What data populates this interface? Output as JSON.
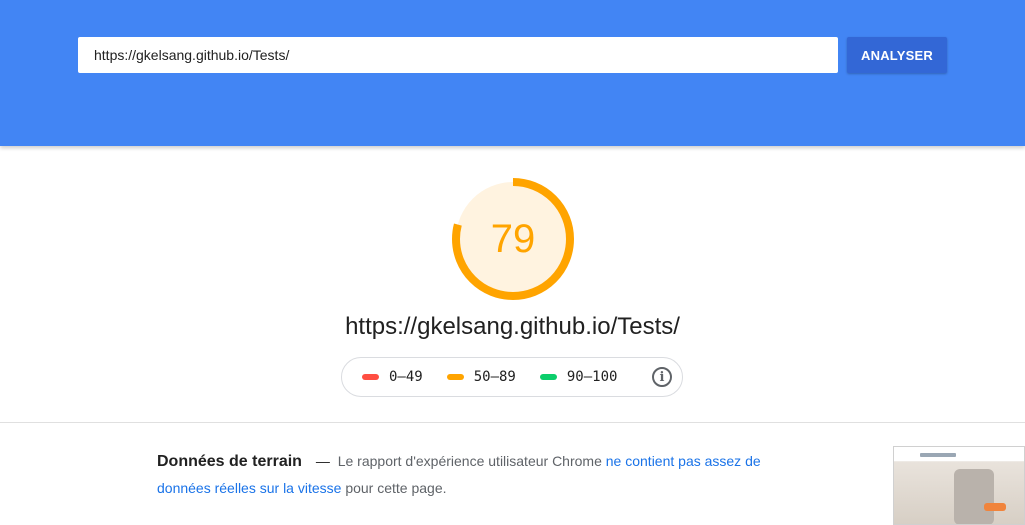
{
  "header": {
    "url_value": "https://gkelsang.github.io/Tests/",
    "analyze_label": "ANALYSER"
  },
  "score": {
    "value": 79,
    "value_text": "79",
    "color": "#ffa400",
    "track_fill": "#fff3e0"
  },
  "tested_url": "https://gkelsang.github.io/Tests/",
  "legend": {
    "items": [
      {
        "label": "0–49",
        "color": "#ff4e42",
        "icon": "red-bar-icon"
      },
      {
        "label": "50–89",
        "color": "#ffa400",
        "icon": "orange-bar-icon"
      },
      {
        "label": "90–100",
        "color": "#0cce6b",
        "icon": "green-bar-icon"
      }
    ],
    "info_icon": "info-icon",
    "info_glyph": "i"
  },
  "field_data": {
    "title": "Données de terrain",
    "dash": "—",
    "text_before": "Le rapport d'expérience utilisateur Chrome",
    "link_text": "ne contient pas assez de données réelles sur la vitesse",
    "text_after": "pour cette page."
  },
  "colors": {
    "header_bg": "#4285f4",
    "button_bg": "#3367d6",
    "link": "#1a73e8"
  }
}
